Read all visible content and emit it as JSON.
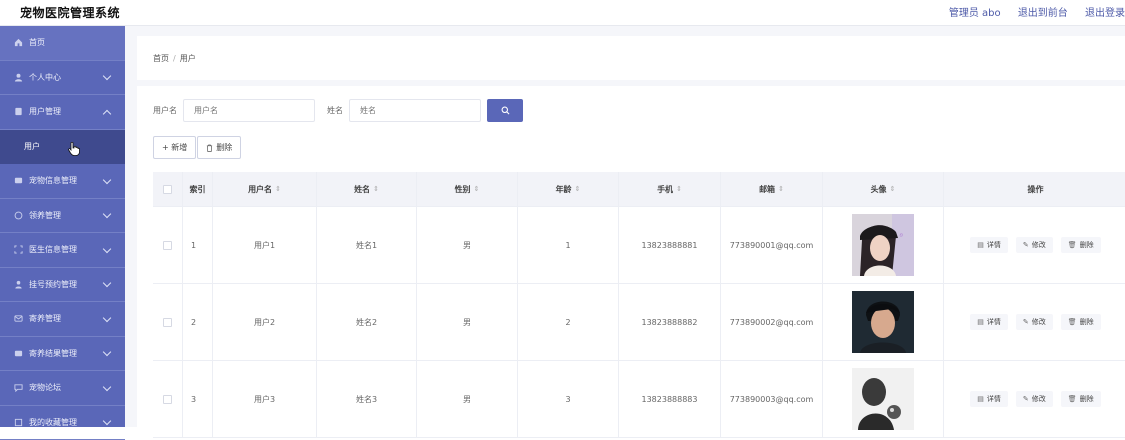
{
  "app": {
    "title": "宠物医院管理系统",
    "admin_label": "管理员 abo",
    "back_label": "退出到前台",
    "logout_label": "退出登录"
  },
  "sidebar": {
    "items": [
      {
        "label": "首页",
        "icon": "home-icon"
      },
      {
        "label": "个人中心",
        "icon": "user-icon"
      },
      {
        "label": "用户管理",
        "icon": "users-icon",
        "expanded": true
      },
      {
        "label": "宠物信息管理",
        "icon": "pet-icon"
      },
      {
        "label": "领养管理",
        "icon": "adopt-icon"
      },
      {
        "label": "医生信息管理",
        "icon": "doctor-icon"
      },
      {
        "label": "挂号预约管理",
        "icon": "appointment-icon"
      },
      {
        "label": "寄养管理",
        "icon": "foster-icon"
      },
      {
        "label": "寄养结果管理",
        "icon": "result-icon"
      },
      {
        "label": "宠物论坛",
        "icon": "forum-icon"
      },
      {
        "label": "我的收藏管理",
        "icon": "favorite-icon"
      }
    ],
    "submenu": {
      "label": "用户"
    }
  },
  "breadcrumb": {
    "home": "首页",
    "sep": "/",
    "current": "用户"
  },
  "search": {
    "username_label": "用户名",
    "username_placeholder": "用户名",
    "name_label": "姓名",
    "name_placeholder": "姓名"
  },
  "actions": {
    "add_label": "+ 新增",
    "delete_label": "删除"
  },
  "table": {
    "headers": {
      "index": "索引",
      "username": "用户名",
      "name": "姓名",
      "gender": "性别",
      "age": "年龄",
      "phone": "手机",
      "email": "邮箱",
      "avatar": "头像",
      "ops": "操作"
    },
    "sort_glyph": "⇕",
    "ops": {
      "detail": "详情",
      "edit": "修改",
      "delete": "删除"
    },
    "rows": [
      {
        "index": "1",
        "username": "用户1",
        "name": "姓名1",
        "gender": "男",
        "age": "1",
        "phone": "13823888881",
        "email": "773890001@qq.com"
      },
      {
        "index": "2",
        "username": "用户2",
        "name": "姓名2",
        "gender": "男",
        "age": "2",
        "phone": "13823888882",
        "email": "773890002@qq.com"
      },
      {
        "index": "3",
        "username": "用户3",
        "name": "姓名3",
        "gender": "男",
        "age": "3",
        "phone": "13823888883",
        "email": "773890003@qq.com"
      }
    ]
  },
  "colors": {
    "accent": "#5a67b8",
    "sidebar_dark": "#3f4a8e"
  }
}
